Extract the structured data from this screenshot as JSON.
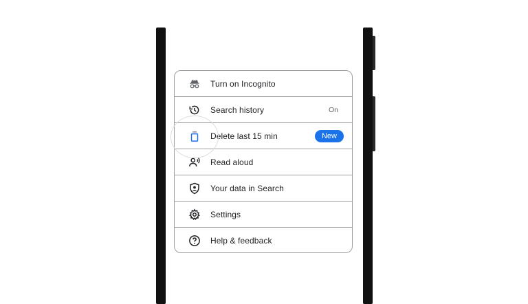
{
  "menu": {
    "items": [
      {
        "label": "Turn on Incognito",
        "icon": "incognito-icon"
      },
      {
        "label": "Search history",
        "icon": "history-icon",
        "status": "On"
      },
      {
        "label": "Delete last 15 min",
        "icon": "delete-icon",
        "badge": "New"
      },
      {
        "label": "Read aloud",
        "icon": "read-aloud-icon"
      },
      {
        "label": "Your data in Search",
        "icon": "shield-account-icon"
      },
      {
        "label": "Settings",
        "icon": "gear-icon"
      },
      {
        "label": "Help & feedback",
        "icon": "help-icon"
      }
    ]
  },
  "colors": {
    "accent": "#1a73e8",
    "icon_gray": "#5f6368",
    "text": "#202124",
    "divider": "#9e9e9e"
  }
}
